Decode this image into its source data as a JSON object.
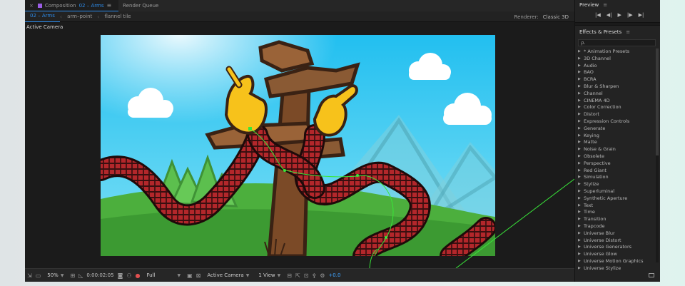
{
  "tabs": {
    "composition_label": "Composition",
    "composition_name": "02 – Arms",
    "render_queue": "Render Queue",
    "menu_glyph": "≡",
    "close_glyph": "×"
  },
  "breadcrumbs": [
    {
      "label": "02 – Arms"
    },
    {
      "label": "arm–point"
    },
    {
      "label": "flannel tile"
    }
  ],
  "renderer": {
    "label": "Renderer:",
    "value": "Classic 3D"
  },
  "viewer": {
    "camera_label": "Active Camera"
  },
  "toolbar": {
    "zoom": "50%",
    "timecode": "0:00:02:05",
    "resolution": "Full",
    "view": "Active Camera",
    "layout": "1 View",
    "exposure": "+0.0"
  },
  "preview": {
    "title": "Preview",
    "menu_glyph": "≡",
    "controls": [
      "|◀",
      "◀|",
      "▶",
      "|▶",
      "▶|"
    ]
  },
  "effects": {
    "title": "Effects & Presets",
    "menu_glyph": "≡",
    "search_placeholder": "ρ.",
    "items": [
      "* Animation Presets",
      "3D Channel",
      "Audio",
      "BAO",
      "BCRA",
      "Blur & Sharpen",
      "Channel",
      "CINEMA 4D",
      "Color Correction",
      "Distort",
      "Expression Controls",
      "Generate",
      "Keying",
      "Matte",
      "Noise & Grain",
      "Obsolete",
      "Perspective",
      "Red Giant",
      "Simulation",
      "Stylize",
      "Superluminal",
      "Synthetic Aperture",
      "Text",
      "Time",
      "Transition",
      "Trapcode",
      "Universe Blur",
      "Universe Distort",
      "Universe Generators",
      "Universe Glow",
      "Universe Motion Graphics",
      "Universe Stylize"
    ]
  },
  "colors": {
    "accent": "#2d8ceb",
    "sky_top": "#2ec4ef",
    "grass": "#4caf3d",
    "flannel_red": "#b3272b",
    "wood": "#8a5a34",
    "hand_yellow": "#f7c21b",
    "motion_path": "#39e639"
  }
}
